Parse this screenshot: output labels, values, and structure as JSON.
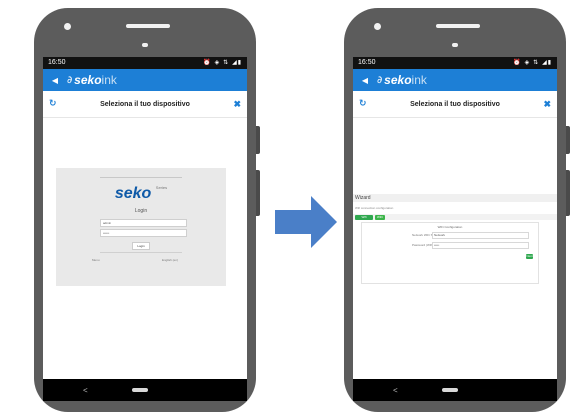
{
  "colors": {
    "brand_blue": "#1d7fd6",
    "seko_blue": "#0f5aa8",
    "accent_green": "#2fa84f",
    "arrow_blue": "#4a7fc8"
  },
  "phones": {
    "left": {
      "status": {
        "time": "16:50",
        "icons": "⏰ ◈ ⇅ ◢▮"
      },
      "appbar": {
        "back_icon": "◀",
        "logo_prefix": "seko",
        "logo_suffix": "ink"
      },
      "titlebar": {
        "refresh_icon": "↻",
        "title": "Seleziona il tuo dispositivo",
        "close": "✖"
      },
      "login": {
        "brand": "seko",
        "brand_sub": "Series",
        "title": "Login",
        "username": "admin",
        "password": "••••••",
        "button": "Login",
        "lang_left": "Menu",
        "lang_right": "English (en)"
      },
      "nav": {
        "back_icon": "<"
      }
    },
    "right": {
      "status": {
        "time": "16:50",
        "icons": "⏰ ◈ ⇅ ◢▮"
      },
      "appbar": {
        "back_icon": "◀",
        "logo_prefix": "seko",
        "logo_suffix": "ink"
      },
      "titlebar": {
        "refresh_icon": "↻",
        "title": "Seleziona il tuo dispositivo",
        "close": "✖"
      },
      "wizard": {
        "header": "Wizard",
        "subtitle": "Wifi connection configuration",
        "tab1": "Wifi connection",
        "tab2": "WiFi",
        "body_title": "WiFi Configuration",
        "label1": "Network WiFi SSID",
        "value1": "Network",
        "label2": "Password (WPA2)",
        "value2": "•••••",
        "next": "Next"
      },
      "nav": {
        "back_icon": "<"
      }
    }
  }
}
